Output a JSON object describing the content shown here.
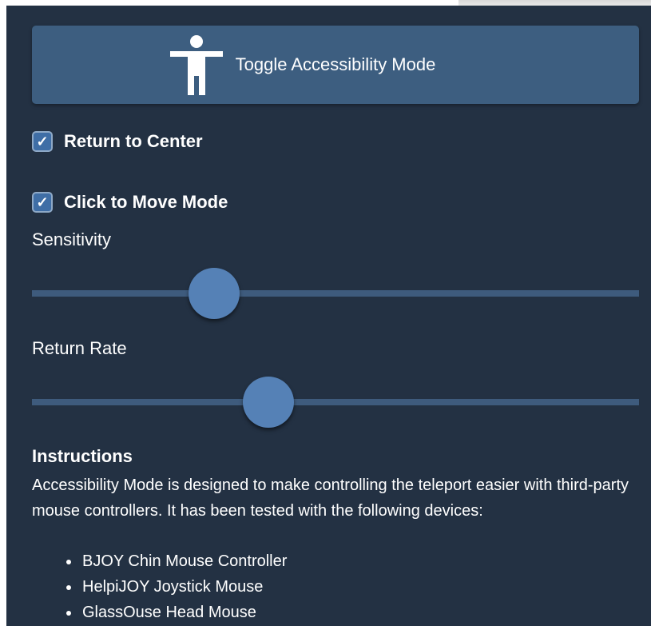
{
  "toggle_button": {
    "label": "Toggle Accessibility Mode",
    "icon": "accessibility-person-icon"
  },
  "options": [
    {
      "label": "Return to Center",
      "checked": true
    },
    {
      "label": "Click to Move Mode",
      "checked": true
    }
  ],
  "sliders": [
    {
      "label": "Sensitivity",
      "value_fraction": 0.3
    },
    {
      "label": "Return Rate",
      "value_fraction": 0.39
    }
  ],
  "instructions": {
    "title": "Instructions",
    "body": "Accessibility Mode is designed to make controlling the teleport easier with third-party mouse controllers. It has been tested with the following devices:",
    "devices": [
      "BJOY Chin Mouse Controller",
      "HelpiJOY Joystick Mouse",
      "GlassOuse Head Mouse"
    ]
  },
  "colors": {
    "panel_background": "#233143",
    "button_background": "#3d5e80",
    "checkbox_fill": "#3f6ea6",
    "slider_track": "#3e5b7d",
    "slider_thumb": "#5581b6",
    "text": "#ffffff"
  }
}
